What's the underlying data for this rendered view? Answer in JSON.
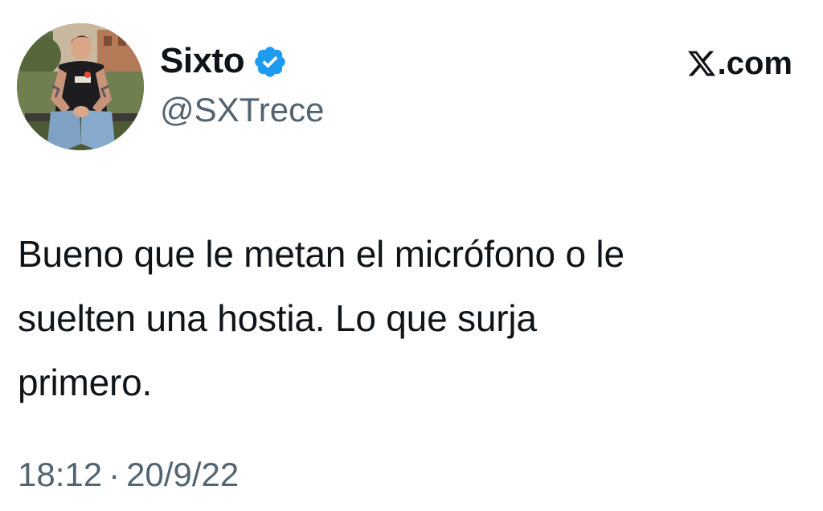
{
  "author": {
    "display_name": "Sixto",
    "handle": "@SXTrece",
    "verified": true,
    "verified_color": "#1d9bf0",
    "avatar_icon": "profile-photo"
  },
  "brand": {
    "icon": "x-logo-icon",
    "text": ".com"
  },
  "tweet": {
    "lines": [
      "Bueno que le metan el micrófono o le",
      "suelten una hostia. Lo que surja",
      "primero."
    ]
  },
  "meta": {
    "time": "18:12",
    "separator": "·",
    "date": "20/9/22"
  },
  "colors": {
    "text_primary": "#0f1419",
    "text_secondary": "#536471",
    "background": "#ffffff"
  }
}
